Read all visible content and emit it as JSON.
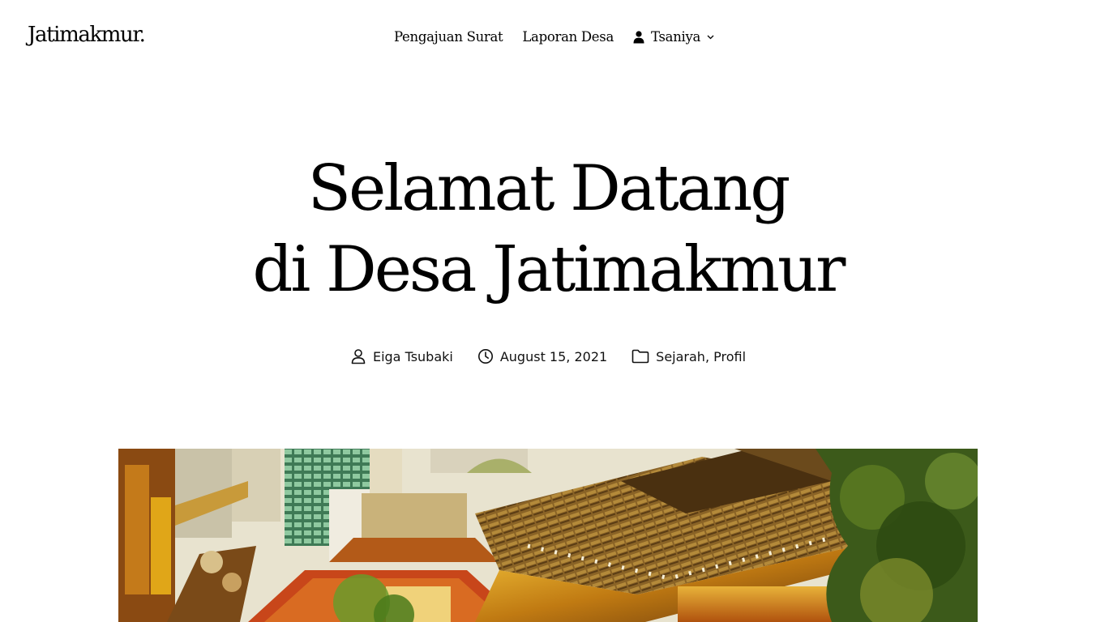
{
  "header": {
    "site_title": "Jatimakmur.",
    "nav": {
      "items": [
        "Pengajuan Surat",
        "Laporan Desa"
      ],
      "user_label": "Tsaniya"
    }
  },
  "post": {
    "title_line1": "Selamat Datang",
    "title_line2": "di Desa Jatimakmur",
    "meta": {
      "author": "Eiga Tsubaki",
      "date": "August 15, 2021",
      "category_1": "Sejarah",
      "separator": ", ",
      "category_2": "Profil"
    }
  },
  "icons": {
    "user_nav": "user-solid-icon",
    "dropdown": "chevron-down-icon",
    "author": "person-outline-icon",
    "date": "clock-icon",
    "categories": "folder-icon"
  },
  "colors": {
    "background": "#ffffff",
    "text": "#000000",
    "photo_sky": "#e8e3cf",
    "photo_roof": "#6b4a1c",
    "photo_gold": "#e0a618",
    "photo_tree": "#3c5a1a"
  }
}
